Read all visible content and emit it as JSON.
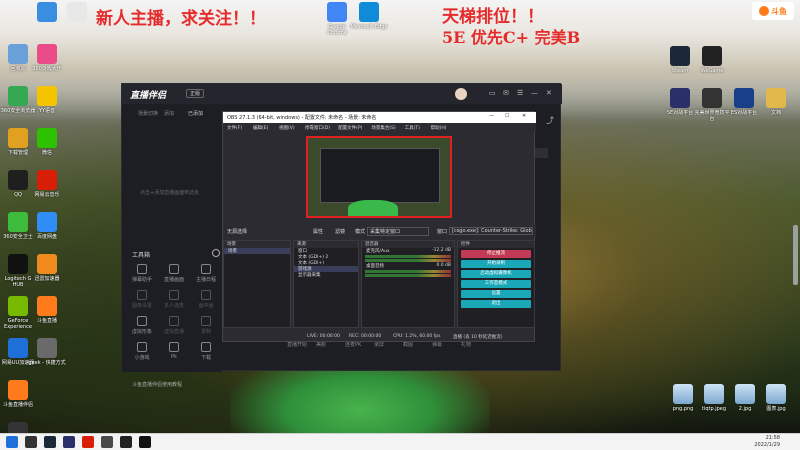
{
  "overlay": {
    "left_text": "新人主播，求关注！！",
    "right_line1": "天梯排位！！",
    "right_line2": "5E 优先C+    完美B"
  },
  "desktop_icons_left": [
    {
      "label": "回收站",
      "color": "#6aa0d8",
      "icon": "recycle-bin-icon"
    },
    {
      "label": "360安全浏览器",
      "color": "#35a853",
      "icon": "360-browser-icon"
    },
    {
      "label": "下载管理",
      "color": "#e0a020",
      "icon": "download-icon"
    },
    {
      "label": "QQ",
      "color": "#1f1f1f",
      "icon": "qq-icon"
    },
    {
      "label": "360安全卫士",
      "color": "#3dbb3d",
      "icon": "360-guard-icon"
    },
    {
      "label": "Logitech G HUB",
      "color": "#111111",
      "icon": "logitech-icon"
    },
    {
      "label": "GeForce Experience",
      "color": "#76b900",
      "icon": "geforce-icon"
    },
    {
      "label": "网易UU加速器",
      "color": "#1e6fd9",
      "icon": "uu-icon"
    },
    {
      "label": "斗鱼直播伴侣",
      "color": "#ff7a1a",
      "icon": "douyu-icon"
    },
    {
      "label": "OBS Studio",
      "color": "#333333",
      "icon": "obs-icon"
    }
  ],
  "desktop_icons_left2": [
    {
      "label": "",
      "color": "#3a8de0",
      "icon": "app-icon"
    },
    {
      "label": "360游戏大厅",
      "color": "#ea4c8a",
      "icon": "game-hall-icon"
    },
    {
      "label": "YY语音",
      "color": "#f5c400",
      "icon": "yy-icon"
    },
    {
      "label": "微信",
      "color": "#2dc100",
      "icon": "wechat-icon"
    },
    {
      "label": "网易云音乐",
      "color": "#d81e06",
      "icon": "netease-music-icon"
    },
    {
      "label": "百度网盘",
      "color": "#2f8df5",
      "icon": "baidu-pan-icon"
    },
    {
      "label": "迅雷加速器",
      "color": "#f08a1d",
      "icon": "thunder-icon"
    },
    {
      "label": "斗鱼直播",
      "color": "#ff7a1a",
      "icon": "douyu-live-icon"
    },
    {
      "label": "geek - 快捷方式",
      "color": "#6a6a6a",
      "icon": "geek-icon"
    }
  ],
  "desktop_icons_top": [
    {
      "label": "",
      "color": "#e8e8e8",
      "icon": "file-icon"
    },
    {
      "label": "Google Chrome",
      "color": "#4285f4",
      "icon": "chrome-icon"
    },
    {
      "label": "Microsoft Edge",
      "color": "#0f8bd8",
      "icon": "edge-icon"
    },
    {
      "label": "WPS Office",
      "color": "#d5252a",
      "icon": "wps-icon"
    }
  ],
  "desktop_icons_right": [
    {
      "label": "Steam",
      "color": "#1b2838",
      "icon": "steam-icon"
    },
    {
      "label": "WeGame",
      "color": "#222222",
      "icon": "wegame-icon"
    },
    {
      "label": "5E对战平台",
      "color": "#2a2f6a",
      "icon": "5e-icon"
    },
    {
      "label": "完美世界竞技平台",
      "color": "#333333",
      "icon": "perfect-world-icon"
    },
    {
      "label": "ES对战平台",
      "color": "#1a3f8a",
      "icon": "es-icon"
    },
    {
      "label": "文档",
      "color": "#e2b84a",
      "icon": "folder-icon"
    }
  ],
  "desktop_files_bottom": [
    {
      "label": "png.png"
    },
    {
      "label": "tiqtp.jpeg"
    },
    {
      "label": "2.jpg"
    },
    {
      "label": "图表.jpg"
    }
  ],
  "app": {
    "logo": "直播伴侣",
    "badge": "正版",
    "tabs": [
      "场景切换",
      "添加",
      "已添加"
    ],
    "empty_hint": "点击+添加直播画面到此处",
    "tools_title": "工具箱",
    "tools": [
      {
        "label": "弹幕助手",
        "dim": false
      },
      {
        "label": "直播画面",
        "dim": false
      },
      {
        "label": "主播日程",
        "dim": false
      },
      {
        "label": "图像设置",
        "dim": true
      },
      {
        "label": "多人连麦",
        "dim": true
      },
      {
        "label": "画中画",
        "dim": true
      },
      {
        "label": "虚拟形象",
        "dim": false
      },
      {
        "label": "虚拟直播",
        "dim": true
      },
      {
        "label": "录制",
        "dim": true
      },
      {
        "label": "小游戏",
        "dim": false
      },
      {
        "label": "Pk",
        "dim": false
      },
      {
        "label": "下载",
        "dim": false
      }
    ],
    "notice": "斗鱼直播伴侣使用教程",
    "bottom_items": [
      "直播开始",
      "美颜",
      "连麦PK",
      "录屏",
      "截图",
      "弹幕",
      "礼物"
    ]
  },
  "obs": {
    "title": "OBS 27.1.3 (64-bit, windows) - 配置文件: 未命名 - 场景: 未命名",
    "menu": [
      "文件(F)",
      "编辑(E)",
      "视图(V)",
      "停靠窗口(D)",
      "配置文件(P)",
      "场景集合(S)",
      "工具(T)",
      "帮助(H)"
    ],
    "toolbar": {
      "scene_label": "无源选择",
      "props": "属性",
      "filters": "滤镜",
      "mode_label": "模式",
      "mode_value": "采集特定窗口",
      "window_label": "窗口",
      "window_value": "[csgo.exe]: Counter-Strike: Global Of"
    },
    "scenes_title": "场景",
    "scenes": [
      {
        "name": "场景",
        "selected": true
      }
    ],
    "sources_title": "来源",
    "sources": [
      {
        "name": "窗口",
        "selected": false
      },
      {
        "name": "文本 (GDI+) 2",
        "selected": false
      },
      {
        "name": "文本 (GDI+)",
        "selected": false
      },
      {
        "name": "游戏源",
        "selected": true
      },
      {
        "name": "显示器采集",
        "selected": false
      }
    ],
    "mixer_title": "混音器",
    "mixer": [
      {
        "name": "麦克风/Aux",
        "db": "-12.2 dB"
      },
      {
        "name": "桌面音频",
        "db": "0.0 dB"
      }
    ],
    "controls_title": "控件",
    "controls": [
      "停止推流",
      "开始录制",
      "启动虚拟摄像机",
      "工作室模式",
      "设置",
      "退出"
    ],
    "status": {
      "live": "LIVE: 00:00:00",
      "rec": "REC: 00:00:00",
      "cpu": "CPU: 1.2%, 60.00 fps",
      "fps_note": "直播 (丢 10 秒延迟推流)"
    }
  },
  "taskbar": {
    "time": "21:58",
    "date": "2022/1/29"
  },
  "douyu_logo": "斗鱼"
}
